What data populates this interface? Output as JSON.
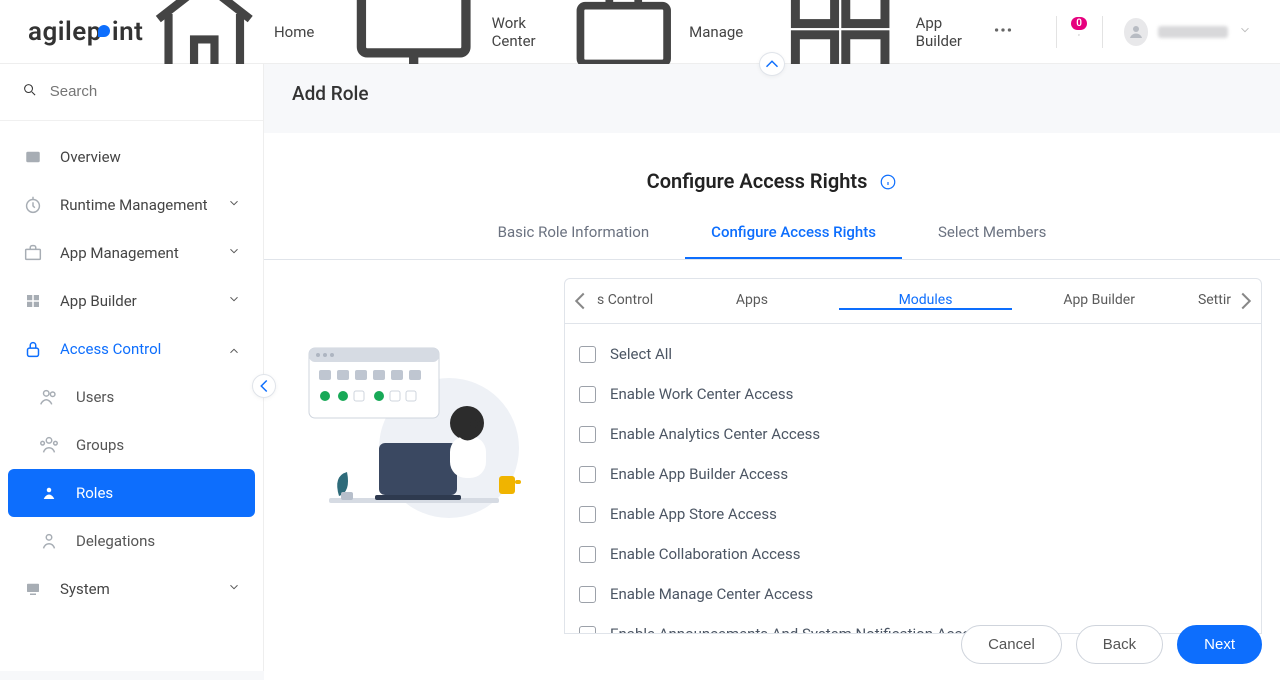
{
  "header": {
    "logo_text_a": "agilep",
    "logo_text_b": "int",
    "nav": {
      "home": "Home",
      "work_center": "Work Center",
      "manage": "Manage",
      "app_builder": "App Builder"
    },
    "notif_count": "0"
  },
  "sidebar": {
    "search_placeholder": "Search",
    "items": {
      "overview": "Overview",
      "runtime": "Runtime Management",
      "app_mgmt": "App Management",
      "app_builder": "App Builder",
      "access_control": "Access Control",
      "users": "Users",
      "groups": "Groups",
      "roles": "Roles",
      "delegations": "Delegations",
      "system": "System"
    }
  },
  "page": {
    "title": "Add Role",
    "section_title": "Configure Access Rights",
    "wiz_tabs": {
      "basic": "Basic Role Information",
      "configure": "Configure Access Rights",
      "members": "Select Members"
    },
    "cat_tabs": {
      "partial_left": "s Control",
      "apps": "Apps",
      "modules": "Modules",
      "app_builder": "App Builder",
      "partial_right": "Settir"
    },
    "checks": {
      "select_all": "Select All",
      "wc": "Enable Work Center Access",
      "analytics": "Enable Analytics Center Access",
      "ab": "Enable App Builder Access",
      "store": "Enable App Store Access",
      "collab": "Enable Collaboration Access",
      "manage": "Enable Manage Center Access",
      "ann": "Enable Announcements And System Notification Access"
    },
    "buttons": {
      "cancel": "Cancel",
      "back": "Back",
      "next": "Next"
    }
  }
}
